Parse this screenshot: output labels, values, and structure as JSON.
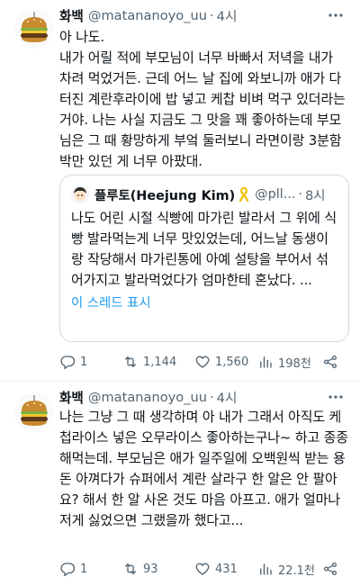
{
  "tweets": [
    {
      "author": {
        "name": "화백",
        "handle": "@matananoyo_uu"
      },
      "separator": "·",
      "time": "4시",
      "text": "아 나도.\n내가 어릴 적에 부모님이 너무 바빠서 저녁을 내가 차려 먹었거든. 근데 어느 날 집에 와보니까 애가 다 터진 계란후라이에 밥 넣고 케찹 비벼 먹구 있더라는 거야. 나는 사실 지금도 그 맛을 꽤 좋아하는데 부모님은 그 때 황망하게 부엌 둘러보니 라면이랑 3분함박만 있던 게 너무 아팠대.",
      "quote": {
        "author": {
          "name": "플루토(Heejung Kim)",
          "handle": "@pll..."
        },
        "separator": "·",
        "time": "8시",
        "text": "나도 어린 시절 식빵에 마가린 발라서 그 위에 식빵 발라먹는게 너무 맛있었는데, 어느날 동생이랑 작당해서 마가린통에 아예 설탕을 부어서 섞어가지고 발라먹었다가 엄마한테 혼났다. ...",
        "thread_link": "이 스레드 표시"
      },
      "stats": {
        "replies": "1",
        "retweets": "1,144",
        "likes": "1,560",
        "views": "198천"
      }
    },
    {
      "author": {
        "name": "화백",
        "handle": "@matananoyo_uu"
      },
      "separator": "·",
      "time": "4시",
      "text": "나는 그냥 그 때 생각하며 아 내가 그래서 아직도 케첩라이스 넣은 오무라이스 좋아하는구나~ 하고 종종 해먹는데. 부모님은 애가 일주일에 오백원씩 받는 용돈 아껴다가 슈퍼에서 계란 살라구 한 알은 안 팔아요? 해서 한 알 사온 것도 마음 아프고. 애가 얼마나 저게 싫었으면 그랬을까 했다고...",
      "stats": {
        "replies": "1",
        "retweets": "93",
        "likes": "431",
        "views": "22.1천"
      }
    }
  ],
  "icons": {
    "more": "more-horizontal-icon",
    "reply": "reply-icon",
    "retweet": "retweet-icon",
    "like": "heart-icon",
    "views": "analytics-icon",
    "share": "share-icon"
  },
  "colors": {
    "text": "#0f1419",
    "secondary": "#536471",
    "link": "#1d9bf0",
    "border": "#cfd9de"
  }
}
